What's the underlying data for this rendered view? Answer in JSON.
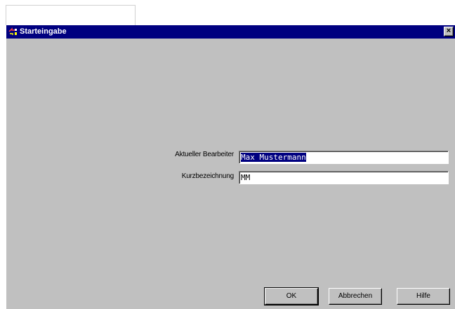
{
  "window": {
    "title": "Starteingabe",
    "close_glyph": "×",
    "icon": "app-icon"
  },
  "form": {
    "bearbeiter_label": "Aktueller Bearbeiter",
    "bearbeiter_value": "Max Mustermann",
    "kurz_label": "Kurzbezeichnung",
    "kurz_value": "MM"
  },
  "buttons": {
    "ok": "OK",
    "cancel": "Abbrechen",
    "help": "Hilfe"
  },
  "colors": {
    "titlebar": "#000080",
    "face": "#c0c0c0",
    "selection": "#000080"
  }
}
